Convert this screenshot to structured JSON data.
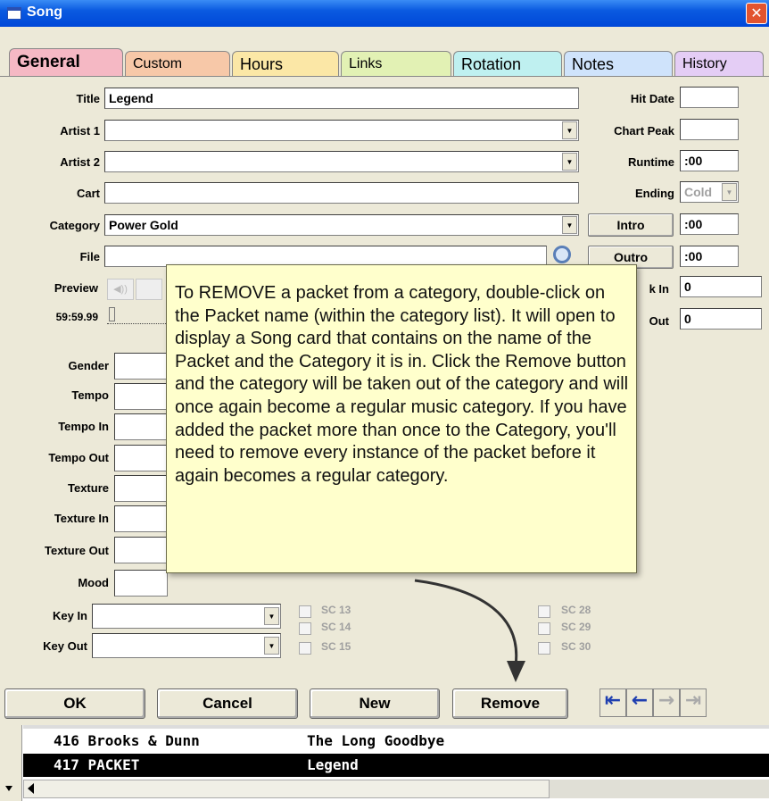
{
  "window": {
    "title": "Song",
    "close_label": "✕"
  },
  "tabs": [
    {
      "label": "General",
      "color": "#f5b8c4"
    },
    {
      "label": "Custom",
      "color": "#f7c8a8"
    },
    {
      "label": "Hours",
      "color": "#fbe7a6"
    },
    {
      "label": "Links",
      "color": "#e2f1b4"
    },
    {
      "label": "Rotation",
      "color": "#bff0f0"
    },
    {
      "label": "Notes",
      "color": "#cfe3fb"
    },
    {
      "label": "History",
      "color": "#e4cdf5"
    }
  ],
  "form": {
    "title_label": "Title",
    "title_value": "Legend",
    "artist1_label": "Artist 1",
    "artist1_value": "",
    "artist2_label": "Artist 2",
    "artist2_value": "",
    "cart_label": "Cart",
    "cart_value": "",
    "category_label": "Category",
    "category_value": "Power Gold",
    "file_label": "File",
    "file_value": "",
    "preview_label": "Preview",
    "duration_label": "59:59.99",
    "gender_label": "Gender",
    "tempo_label": "Tempo",
    "tempo_in_label": "Tempo In",
    "tempo_out_label": "Tempo Out",
    "texture_label": "Texture",
    "texture_in_label": "Texture In",
    "texture_out_label": "Texture Out",
    "mood_label": "Mood",
    "key_in_label": "Key In",
    "key_out_label": "Key Out"
  },
  "right": {
    "hit_date_label": "Hit Date",
    "hit_date_value": "",
    "chart_peak_label": "Chart Peak",
    "chart_peak_value": "",
    "runtime_label": "Runtime",
    "runtime_value": ":00",
    "ending_label": "Ending",
    "ending_value": "Cold",
    "intro_label": "Intro",
    "intro_value": ":00",
    "outro_label": "Outro",
    "outro_value": ":00",
    "hook_in_label": "k In",
    "hook_in_value": "0",
    "hook_out_label": "Out",
    "hook_out_value": "0"
  },
  "checks": {
    "sc13": "SC 13",
    "sc14": "SC 14",
    "sc15": "SC 15",
    "sc28": "SC 28",
    "sc29": "SC 29",
    "sc30": "SC 30"
  },
  "tooltip": {
    "text": "To REMOVE a packet from a category, double-click on the Packet name (within the category list).  It will open to display a Song card that contains on the name of the Packet and the Category it is in.  Click the Remove button and the category will be taken out of the category and will once again become a regular music category.   If you have added the packet more than once to the Category, you'll need to remove every instance of the packet before it again becomes a regular category."
  },
  "buttons": {
    "ok": "OK",
    "cancel": "Cancel",
    "new": "New",
    "remove": "Remove"
  },
  "list": [
    {
      "num": "416 Brooks & Dunn",
      "title": "The Long Goodbye"
    },
    {
      "num": "417 PACKET",
      "title": "Legend"
    }
  ]
}
